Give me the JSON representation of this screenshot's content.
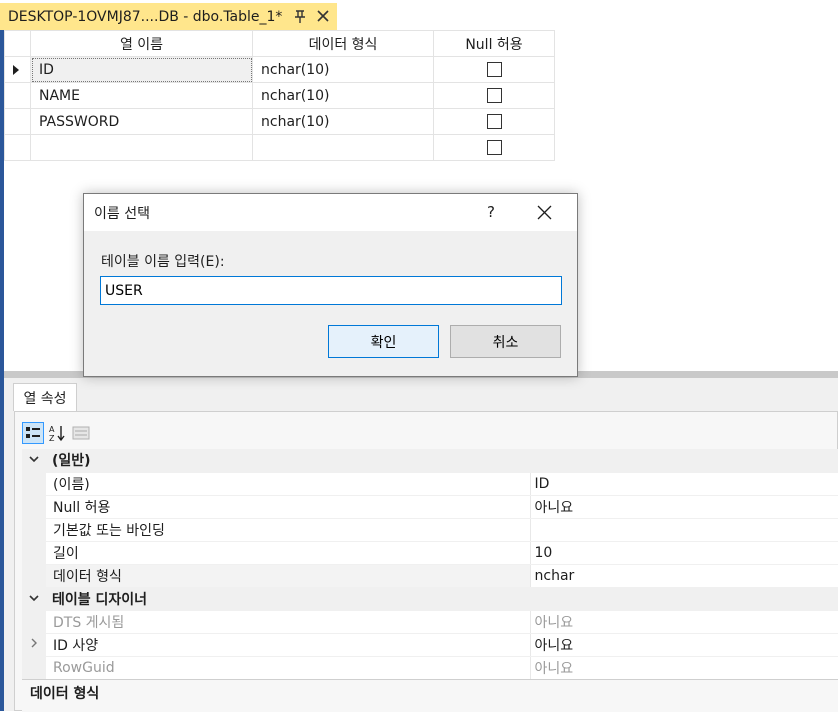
{
  "document_tab": {
    "title": "DESKTOP-1OVMJ87....DB - dbo.Table_1*",
    "accent_color": "#ffe68c"
  },
  "grid": {
    "headers": [
      "열 이름",
      "데이터 형식",
      "Null 허용"
    ],
    "rows": [
      {
        "name": "ID",
        "type": "nchar(10)",
        "allow_null": false,
        "current": true
      },
      {
        "name": "NAME",
        "type": "nchar(10)",
        "allow_null": false,
        "current": false
      },
      {
        "name": "PASSWORD",
        "type": "nchar(10)",
        "allow_null": false,
        "current": false
      },
      {
        "name": "",
        "type": "",
        "allow_null": false,
        "current": false
      }
    ]
  },
  "properties": {
    "tab_label": "열 속성",
    "toolbar_icons": [
      "categorized-icon",
      "alphabetical-icon",
      "property-pages-icon"
    ],
    "categories": [
      {
        "label": "(일반)",
        "items": [
          {
            "name": "(이름)",
            "value": "ID"
          },
          {
            "name": "Null 허용",
            "value": "아니요"
          },
          {
            "name": "기본값 또는 바인딩",
            "value": ""
          },
          {
            "name": "길이",
            "value": "10"
          },
          {
            "name": "데이터 형식",
            "value": "nchar"
          }
        ]
      },
      {
        "label": "테이블 디자이너",
        "items": [
          {
            "name": "DTS 게시됨",
            "value": "아니요",
            "disabled": true
          },
          {
            "name": "ID 사양",
            "value": "아니요",
            "expandable": true
          },
          {
            "name": "RowGuid",
            "value": "아니요",
            "disabled": true
          }
        ]
      }
    ],
    "description_title": "데이터 형식"
  },
  "dialog": {
    "title": "이름 선택",
    "help_label": "?",
    "field_label": "테이블 이름 입력(E):",
    "input_value": "USER",
    "ok_label": "확인",
    "cancel_label": "취소"
  }
}
